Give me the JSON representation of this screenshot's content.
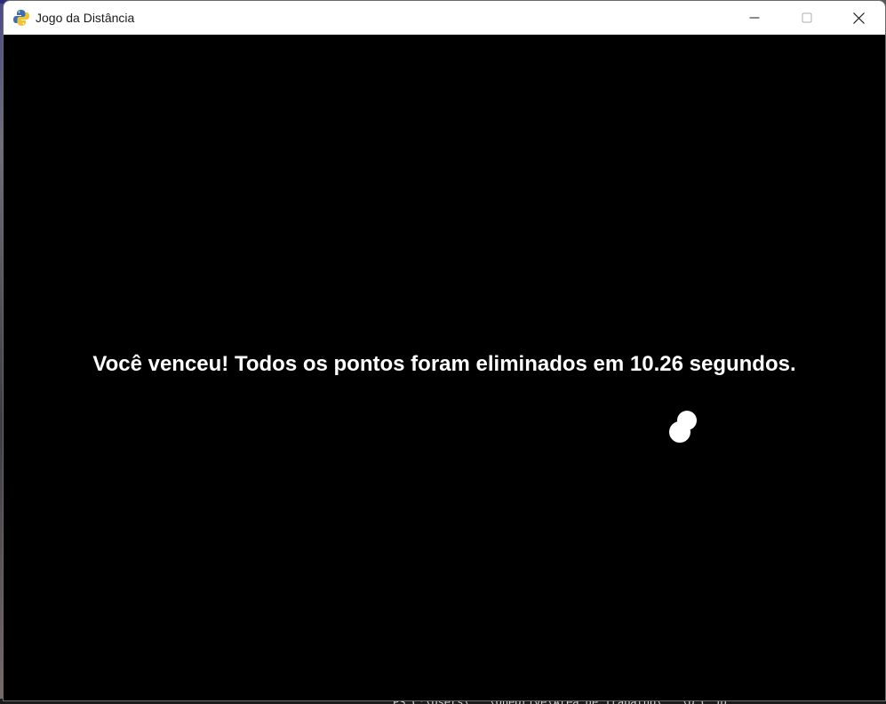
{
  "window": {
    "title": "Jogo da Distância",
    "icon": "pygame-snake-icon",
    "controls": [
      "minimize-icon",
      "maximize-icon",
      "close-icon"
    ]
  },
  "game": {
    "message": "Você venceu! Todos os pontos foram eliminados em 10.26 segundos.",
    "background_color": "#000000",
    "text_color": "#ffffff",
    "remaining_dots": 2
  },
  "background": {
    "terminal_text": "PS C:\\Users\\...\\OneDrive\\Área de Trabalho\\...\\D.C.Jo"
  }
}
